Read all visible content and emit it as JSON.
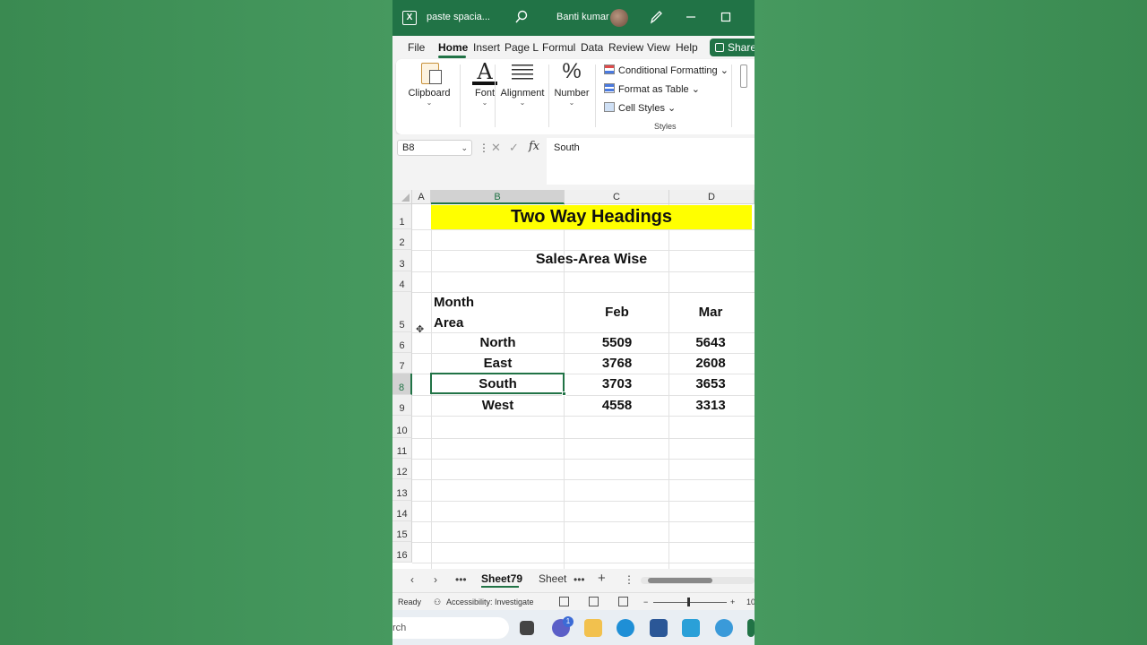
{
  "titlebar": {
    "file_name": "paste spacia...",
    "user_name": "Banti kumar"
  },
  "ribbon": {
    "tabs": [
      {
        "label": "File",
        "active": false
      },
      {
        "label": "Home",
        "active": true
      },
      {
        "label": "Insert",
        "active": false
      },
      {
        "label": "Page La",
        "active": false
      },
      {
        "label": "Formula",
        "active": false
      },
      {
        "label": "Data",
        "active": false
      },
      {
        "label": "Review",
        "active": false
      },
      {
        "label": "View",
        "active": false
      },
      {
        "label": "Help",
        "active": false
      }
    ],
    "share_label": "Share",
    "groups": {
      "clipboard": "Clipboard",
      "font": "Font",
      "font_glyph": "A",
      "alignment": "Alignment",
      "number": "Number",
      "number_glyph": "%"
    },
    "styles": {
      "conditional": "Conditional Formatting",
      "format_table": "Format as Table",
      "cell_styles": "Cell Styles",
      "group_label": "Styles"
    }
  },
  "formula_bar": {
    "name_box": "B8",
    "value": "South",
    "fx": "fx"
  },
  "grid": {
    "columns": [
      "A",
      "B",
      "C",
      "D"
    ],
    "selected_column": "B",
    "rows": [
      "1",
      "2",
      "3",
      "4",
      "5",
      "6",
      "7",
      "8",
      "9",
      "10",
      "11",
      "12",
      "13",
      "14",
      "15",
      "16"
    ],
    "selected_row": "8",
    "title": "Two Way Headings",
    "subtitle": "Sales-Area Wise",
    "header_month": "Month",
    "header_area": "Area",
    "month_headers": [
      "Feb",
      "Mar"
    ],
    "data_rows": [
      {
        "area": "North",
        "feb": "5509",
        "mar": "5643"
      },
      {
        "area": "East",
        "feb": "3768",
        "mar": "2608"
      },
      {
        "area": "South",
        "feb": "3703",
        "mar": "3653"
      },
      {
        "area": "West",
        "feb": "4558",
        "mar": "3313"
      }
    ],
    "title_fill_color": "#ffff00"
  },
  "sheets": {
    "active": "Sheet79",
    "next": "Sheet"
  },
  "status": {
    "ready": "Ready",
    "accessibility": "Accessibility: Investigate",
    "zoom": "10"
  },
  "taskbar": {
    "search_text": "rch",
    "badge": "1"
  },
  "colors": {
    "excel_green": "#217346",
    "background": "#3f8f57"
  }
}
